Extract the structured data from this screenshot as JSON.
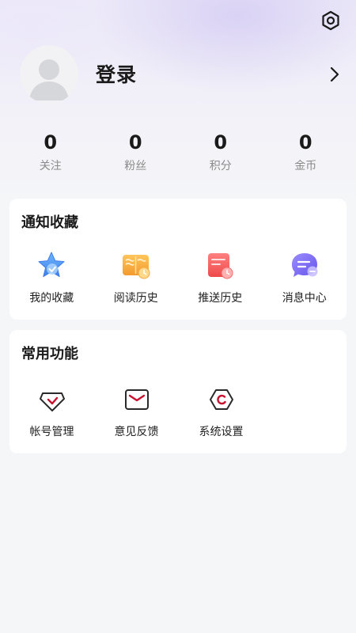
{
  "header": {
    "settings_icon": "gear-icon",
    "login_label": "登录",
    "arrow_icon": "chevron-right-icon"
  },
  "stats": [
    {
      "value": "0",
      "label": "关注"
    },
    {
      "value": "0",
      "label": "粉丝"
    },
    {
      "value": "0",
      "label": "积分"
    },
    {
      "value": "0",
      "label": "金币"
    }
  ],
  "notify_section": {
    "title": "通知收藏",
    "items": [
      {
        "label": "我的收藏",
        "icon": "star-icon"
      },
      {
        "label": "阅读历史",
        "icon": "book-icon"
      },
      {
        "label": "推送历史",
        "icon": "push-history-icon"
      },
      {
        "label": "消息中心",
        "icon": "message-icon"
      }
    ]
  },
  "common_section": {
    "title": "常用功能",
    "items": [
      {
        "label": "帐号管理",
        "icon": "account-icon"
      },
      {
        "label": "意见反馈",
        "icon": "mail-icon"
      },
      {
        "label": "系统设置",
        "icon": "settings-icon"
      }
    ]
  },
  "colors": {
    "accent_red": "#c8102e",
    "star_blue": "#4a8ff0",
    "book_orange": "#f7a93c",
    "push_red": "#f25c5c",
    "message_purple": "#7a6cf0"
  }
}
